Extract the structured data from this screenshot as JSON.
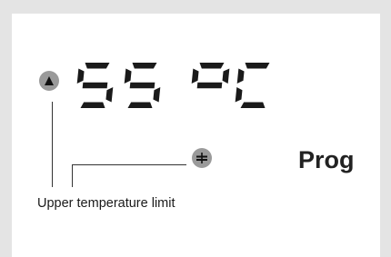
{
  "display": {
    "temperature": "55",
    "unit": "°C",
    "mode_label": "Prog"
  },
  "annotation": {
    "caption": "Upper temperature limit"
  },
  "icons": {
    "upper_limit": "triangle-up-icon",
    "limit_toggle": "min-max-icon"
  },
  "colors": {
    "segment": "#1a1a1a",
    "icon_fill": "#9a9a9a",
    "background": "#e4e4e4",
    "panel": "#ffffff"
  }
}
